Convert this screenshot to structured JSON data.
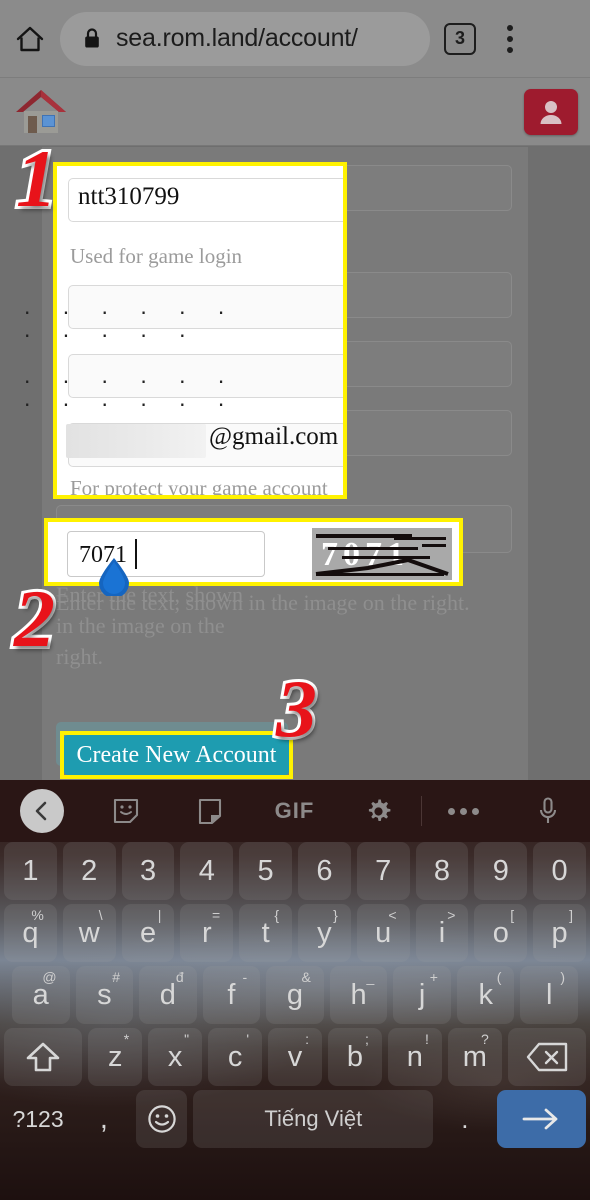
{
  "browser": {
    "home_icon": "home-icon",
    "lock_icon": "lock-icon",
    "url": "sea.rom.land/account/",
    "tab_count": "3",
    "menu_icon": "overflow-menu-icon"
  },
  "site_header": {
    "logo_icon": "house-logo-icon",
    "account_icon": "user-avatar-icon",
    "account_button_color": "#9e1b2e"
  },
  "form": {
    "username": {
      "value": "ntt310799",
      "helper": "Used for game login"
    },
    "password": {
      "masked_value": ". . . . . . . . . . ."
    },
    "confirm_password": {
      "masked_value": ". . . . . . . . . . . ."
    },
    "email": {
      "redacted": true,
      "domain_suffix": "@gmail.com",
      "helper": "For protect your game account"
    },
    "captcha": {
      "value": "7071",
      "image_text": "7071",
      "helper": "Enter the text, shown in the image on the right."
    },
    "submit": {
      "label": "Create New Account",
      "color": "#1e9cb0"
    }
  },
  "annotations": {
    "step1": "1",
    "step2": "2",
    "step3": "3",
    "highlight_color": "#fff200",
    "number_color": "#e8131a"
  },
  "keyboard": {
    "toolbar": [
      {
        "name": "back-chevron-icon",
        "label": ""
      },
      {
        "name": "sticker-icon",
        "label": ""
      },
      {
        "name": "clipboard-icon",
        "label": ""
      },
      {
        "name": "gif-label",
        "label": "GIF"
      },
      {
        "name": "gear-icon",
        "label": ""
      },
      {
        "name": "more-dots-icon",
        "label": ""
      },
      {
        "name": "microphone-icon",
        "label": ""
      }
    ],
    "row_numbers": [
      "1",
      "2",
      "3",
      "4",
      "5",
      "6",
      "7",
      "8",
      "9",
      "0"
    ],
    "row_top": [
      {
        "key": "q",
        "alt": "%"
      },
      {
        "key": "w",
        "alt": "\\"
      },
      {
        "key": "e",
        "alt": "|"
      },
      {
        "key": "r",
        "alt": "="
      },
      {
        "key": "t",
        "alt": "{"
      },
      {
        "key": "y",
        "alt": "}"
      },
      {
        "key": "u",
        "alt": "<"
      },
      {
        "key": "i",
        "alt": ">"
      },
      {
        "key": "o",
        "alt": "["
      },
      {
        "key": "p",
        "alt": "]"
      }
    ],
    "row_home": [
      {
        "key": "a",
        "alt": "@"
      },
      {
        "key": "s",
        "alt": "#"
      },
      {
        "key": "d",
        "alt": "đ"
      },
      {
        "key": "f",
        "alt": "-"
      },
      {
        "key": "g",
        "alt": "&"
      },
      {
        "key": "h",
        "alt": "_"
      },
      {
        "key": "j",
        "alt": "+"
      },
      {
        "key": "k",
        "alt": "("
      },
      {
        "key": "l",
        "alt": ")"
      }
    ],
    "row_bottom": [
      {
        "key": "z",
        "alt": "*"
      },
      {
        "key": "x",
        "alt": "\""
      },
      {
        "key": "c",
        "alt": "'"
      },
      {
        "key": "v",
        "alt": ":"
      },
      {
        "key": "b",
        "alt": ";"
      },
      {
        "key": "n",
        "alt": "!"
      },
      {
        "key": "m",
        "alt": "?"
      }
    ],
    "shift_icon": "shift-up-arrow-icon",
    "backspace_icon": "backspace-icon",
    "row_action": {
      "symbols": "?123",
      "comma": ",",
      "emoji_icon": "emoji-smiley-icon",
      "space_label": "Tiếng Việt",
      "period": ".",
      "enter_icon": "enter-arrow-icon"
    }
  }
}
